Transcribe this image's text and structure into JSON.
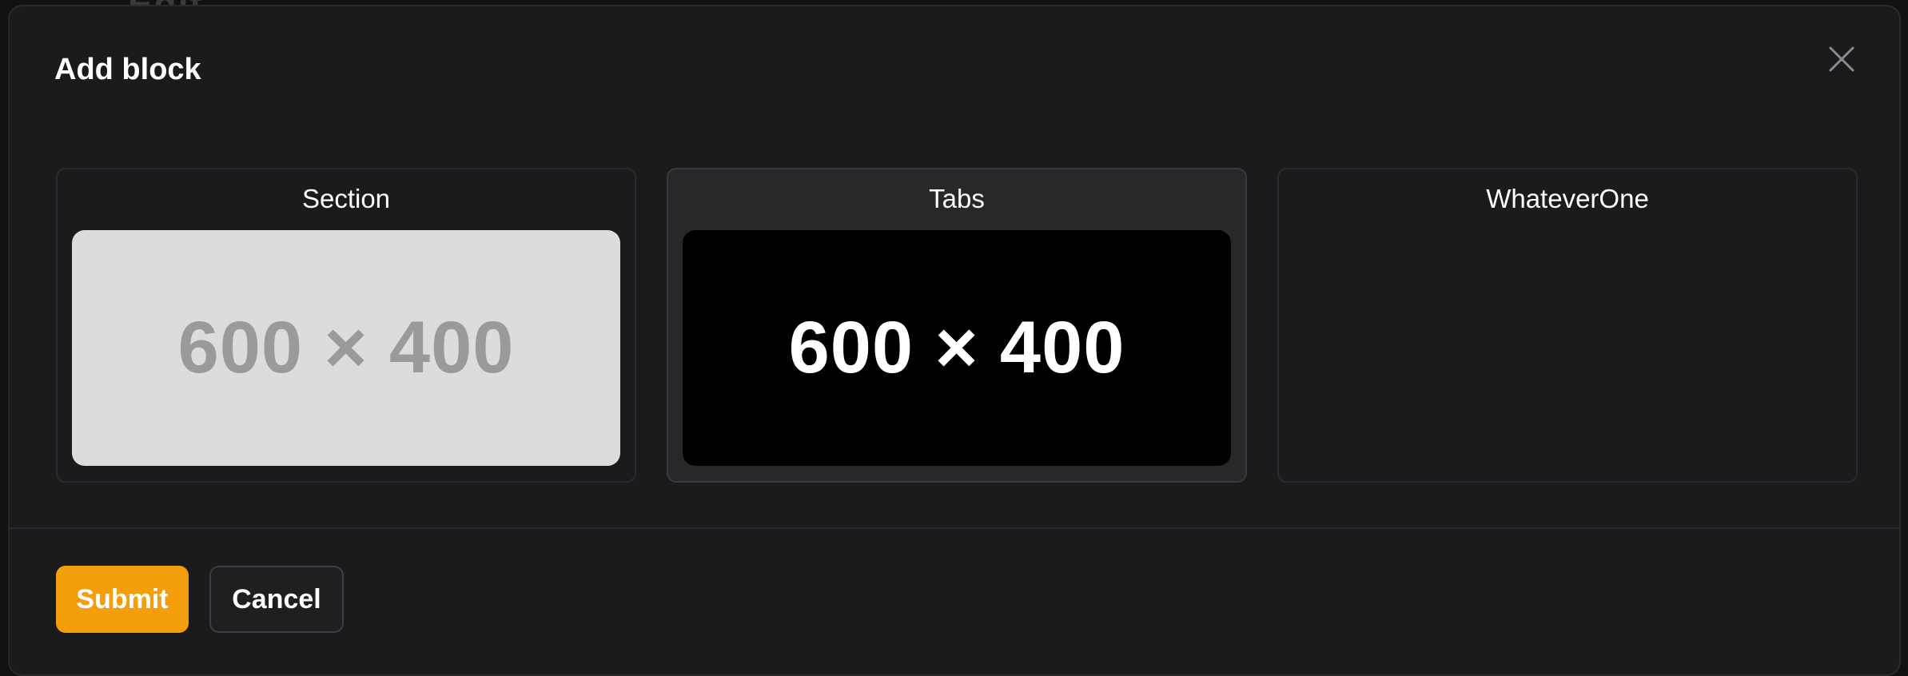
{
  "background": {
    "page_text": "Edit"
  },
  "modal": {
    "title": "Add block",
    "close_icon": "close-icon"
  },
  "blocks": [
    {
      "label": "Section",
      "thumbnail_text": "600 × 400",
      "thumbnail_style": "light",
      "selected": false
    },
    {
      "label": "Tabs",
      "thumbnail_text": "600 × 400",
      "thumbnail_style": "dark",
      "selected": true
    },
    {
      "label": "WhateverOne",
      "thumbnail_text": "",
      "thumbnail_style": "none",
      "selected": false
    }
  ],
  "footer": {
    "submit_label": "Submit",
    "cancel_label": "Cancel"
  },
  "colors": {
    "accent": "#f59e0b",
    "modal_bg": "#1b1b1d",
    "selected_card_bg": "#28282b"
  }
}
